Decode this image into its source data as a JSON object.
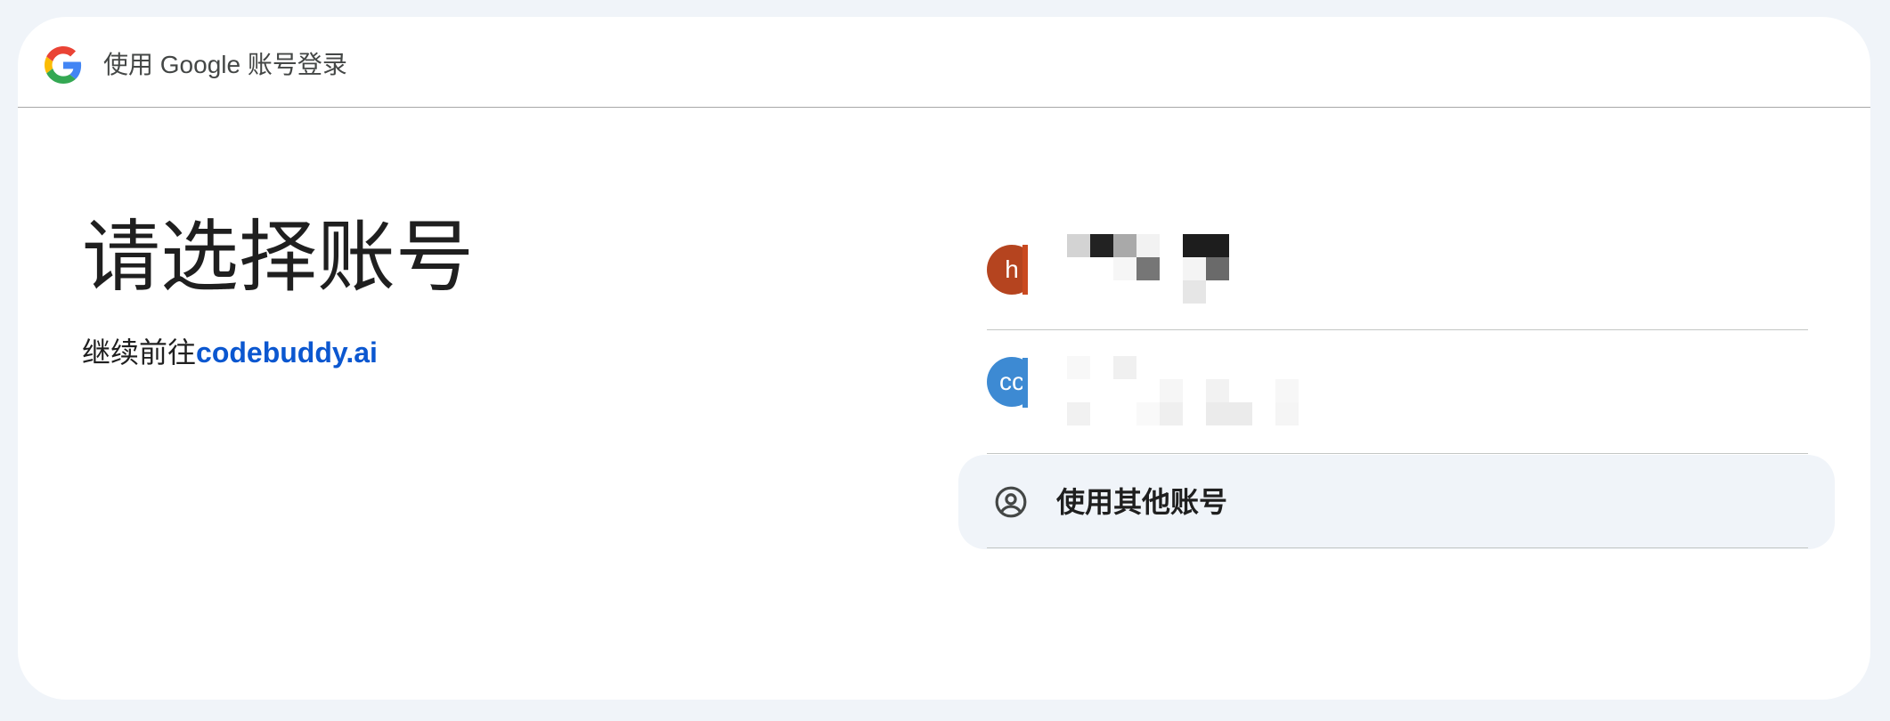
{
  "header": {
    "logo": "google-logo",
    "title": "使用 Google 账号登录"
  },
  "main": {
    "title": "请选择账号",
    "subtitle_prefix": "继续前往",
    "subtitle_link": "codebuddy.ai"
  },
  "accounts": [
    {
      "avatar_text": "h",
      "avatar_color": "#b5441f"
    },
    {
      "avatar_text": "cc",
      "avatar_color": "#3d8ad3"
    }
  ],
  "other_account": {
    "icon": "account-circle-icon",
    "label": "使用其他账号"
  }
}
